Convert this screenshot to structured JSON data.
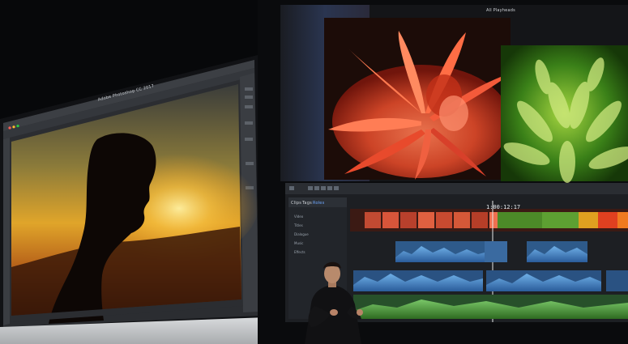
{
  "scene": {
    "background_color": "#07080a"
  },
  "left_display": {
    "app_window_title": "Adobe Photoshop CC 2017",
    "image_subject": "silhouette-at-sunset",
    "accent_color": "#f0a020"
  },
  "right_display": {
    "viewer_title": "All Playheads",
    "timecode": "1:00:12:17",
    "browser_tabs": [
      "Clips",
      "Tags",
      "Roles"
    ],
    "role_list": [
      "Video",
      "Titles",
      "Dialogue",
      "Music",
      "Effects"
    ],
    "accent_color": "#2e6cf0"
  },
  "presenter": {
    "description": "presenter-on-stage"
  }
}
